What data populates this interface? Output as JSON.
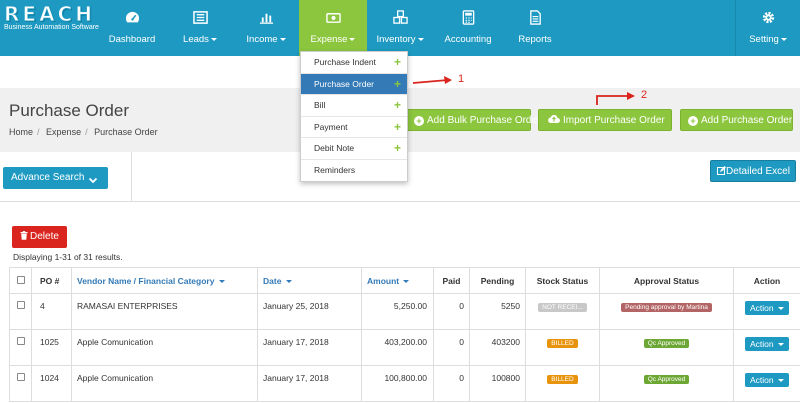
{
  "app": {
    "logo_word": "REACH",
    "logo_sub": "Business Automation Software"
  },
  "nav": [
    {
      "label": "Dashboard",
      "icon": "dashboard-icon"
    },
    {
      "label": "Leads",
      "icon": "leads-icon"
    },
    {
      "label": "Income",
      "icon": "income-icon"
    },
    {
      "label": "Expense",
      "icon": "expense-icon"
    },
    {
      "label": "Inventory",
      "icon": "inventory-icon"
    },
    {
      "label": "Accounting",
      "icon": "accounting-icon"
    },
    {
      "label": "Reports",
      "icon": "reports-icon"
    },
    {
      "label": "Setting",
      "icon": "gear-icon"
    }
  ],
  "expense_menu": [
    "Purchase Indent",
    "Purchase Order",
    "Bill",
    "Payment",
    "Debit Note",
    "Reminders"
  ],
  "page": {
    "title": "Purchase Order",
    "breadcrumb": [
      "Home",
      "Expense",
      "Purchase Order"
    ]
  },
  "actions": {
    "add_bulk": "Add Bulk Purchase Order",
    "import": "Import Purchase Order",
    "add": "Add Purchase Order",
    "advance_search": "Advance Search",
    "detailed_excel": "Detailed Excel",
    "delete": "Delete"
  },
  "summary": "Displaying 1-31 of 31 results.",
  "annotations": [
    "1",
    "2"
  ],
  "table": {
    "headers": [
      "PO #",
      "Vendor Name / Financial Category",
      "Date",
      "Amount",
      "Paid",
      "Pending",
      "Stock Status",
      "Approval Status",
      "Action"
    ],
    "rows": [
      {
        "po": "4",
        "vendor": "RAMASAI ENTERPRISES",
        "date": "January 25, 2018",
        "amount": "5,250.00",
        "paid": "0",
        "pending": "5250",
        "stock": "NOT RECEI...",
        "approval": "Pending approval by Martina",
        "action": "Action"
      },
      {
        "po": "1025",
        "vendor": "Apple Comunication",
        "date": "January 17, 2018",
        "amount": "403,200.00",
        "paid": "0",
        "pending": "403200",
        "stock": "BILLED",
        "approval": "Qc Approved",
        "action": "Action"
      },
      {
        "po": "1024",
        "vendor": "Apple Comunication",
        "date": "January 17, 2018",
        "amount": "100,800.00",
        "paid": "0",
        "pending": "100800",
        "stock": "BILLED",
        "approval": "Qc Approved",
        "action": "Action"
      }
    ]
  },
  "colors": {
    "nav_bg": "#1e9ac2",
    "active_green": "#8cc63e",
    "danger": "#d9251d",
    "not_received": "#c8c8c8",
    "billed": "#e8930c",
    "pending_approval": "#b36565",
    "approved": "#6ca734"
  }
}
